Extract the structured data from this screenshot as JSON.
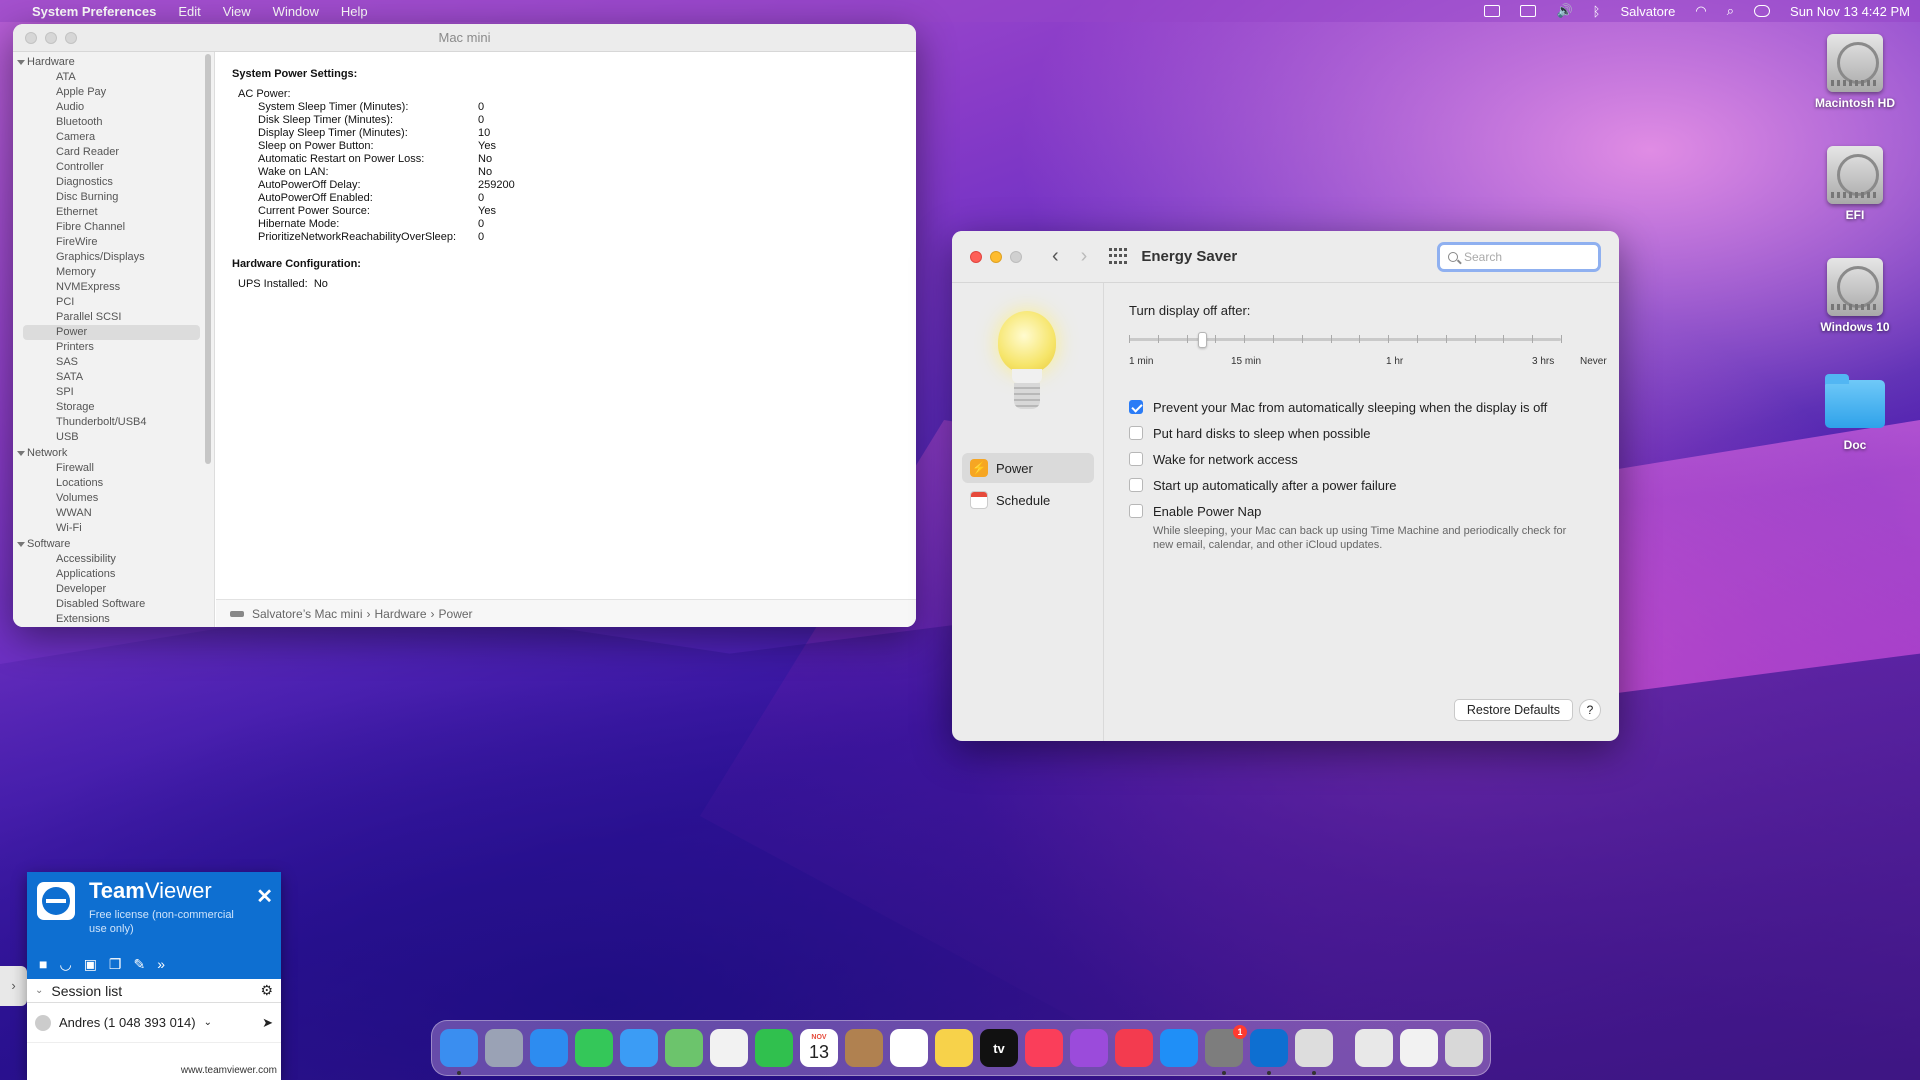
{
  "menubar": {
    "apple": "",
    "app": "System Preferences",
    "items": [
      "Edit",
      "View",
      "Window",
      "Help"
    ],
    "user": "Salvatore",
    "clock": "Sun Nov 13  4:42 PM"
  },
  "sysinfo": {
    "title": "Mac mini",
    "tree": [
      {
        "h": "Hardware"
      },
      {
        "i": "ATA"
      },
      {
        "i": "Apple Pay"
      },
      {
        "i": "Audio"
      },
      {
        "i": "Bluetooth"
      },
      {
        "i": "Camera"
      },
      {
        "i": "Card Reader"
      },
      {
        "i": "Controller"
      },
      {
        "i": "Diagnostics"
      },
      {
        "i": "Disc Burning"
      },
      {
        "i": "Ethernet"
      },
      {
        "i": "Fibre Channel"
      },
      {
        "i": "FireWire"
      },
      {
        "i": "Graphics/Displays"
      },
      {
        "i": "Memory"
      },
      {
        "i": "NVMExpress"
      },
      {
        "i": "PCI"
      },
      {
        "i": "Parallel SCSI"
      },
      {
        "i": "Power",
        "sel": true
      },
      {
        "i": "Printers"
      },
      {
        "i": "SAS"
      },
      {
        "i": "SATA"
      },
      {
        "i": "SPI"
      },
      {
        "i": "Storage"
      },
      {
        "i": "Thunderbolt/USB4"
      },
      {
        "i": "USB"
      },
      {
        "h": "Network"
      },
      {
        "i": "Firewall"
      },
      {
        "i": "Locations"
      },
      {
        "i": "Volumes"
      },
      {
        "i": "WWAN"
      },
      {
        "i": "Wi-Fi"
      },
      {
        "h": "Software"
      },
      {
        "i": "Accessibility"
      },
      {
        "i": "Applications"
      },
      {
        "i": "Developer"
      },
      {
        "i": "Disabled Software"
      },
      {
        "i": "Extensions"
      }
    ],
    "heading1": "System Power Settings:",
    "ac_power": "AC Power:",
    "settings": [
      {
        "k": "System Sleep Timer (Minutes):",
        "v": "0"
      },
      {
        "k": "Disk Sleep Timer (Minutes):",
        "v": "0"
      },
      {
        "k": "Display Sleep Timer (Minutes):",
        "v": "10"
      },
      {
        "k": "Sleep on Power Button:",
        "v": "Yes"
      },
      {
        "k": "Automatic Restart on Power Loss:",
        "v": "No"
      },
      {
        "k": "Wake on LAN:",
        "v": "No"
      },
      {
        "k": "AutoPowerOff Delay:",
        "v": "259200"
      },
      {
        "k": "AutoPowerOff Enabled:",
        "v": "0"
      },
      {
        "k": "Current Power Source:",
        "v": "Yes"
      },
      {
        "k": "Hibernate Mode:",
        "v": "0"
      },
      {
        "k": "PrioritizeNetworkReachabilityOverSleep:",
        "v": "0"
      }
    ],
    "heading2": "Hardware Configuration:",
    "ups_label": "UPS Installed:",
    "ups_value": "No",
    "path": [
      "Salvatore’s Mac mini",
      "Hardware",
      "Power"
    ]
  },
  "energy": {
    "title": "Energy Saver",
    "search_placeholder": "Search",
    "sidebar": [
      {
        "label": "Power",
        "icon": "power-icon"
      },
      {
        "label": "Schedule",
        "icon": "calendar-icon"
      }
    ],
    "slider_label": "Turn display off after:",
    "slider_scale": [
      "1 min",
      "15 min",
      "1 hr",
      "3 hrs",
      "Never"
    ],
    "slider_ticks": 16,
    "slider_value_fraction": 0.17,
    "options": [
      {
        "label": "Prevent your Mac from automatically sleeping when the display is off",
        "checked": true
      },
      {
        "label": "Put hard disks to sleep when possible",
        "checked": false
      },
      {
        "label": "Wake for network access",
        "checked": false
      },
      {
        "label": "Start up automatically after a power failure",
        "checked": false
      },
      {
        "label": "Enable Power Nap",
        "checked": false
      }
    ],
    "power_nap_note": "While sleeping, your Mac can back up using Time Machine and periodically check for new email, calendar, and other iCloud updates.",
    "restore_label": "Restore Defaults",
    "help_label": "?"
  },
  "desktop": [
    "Macintosh HD",
    "EFI",
    "Windows 10",
    "Doc"
  ],
  "teamviewer": {
    "name_bold": "Team",
    "name_rest": "Viewer",
    "license": "Free license (non-commercial use only)",
    "session_list": "Session list",
    "user": "Andres (1 048 393 014)",
    "url": "www.teamviewer.com"
  },
  "dock": {
    "calendar_month": "NOV",
    "calendar_day": "13",
    "tv_label": "tv",
    "badge": "1",
    "apps": [
      {
        "name": "finder",
        "color": "#3a8ef0",
        "run": true
      },
      {
        "name": "launchpad",
        "color": "#9aa2b5"
      },
      {
        "name": "safari",
        "color": "#2d8cf0"
      },
      {
        "name": "messages",
        "color": "#34c759"
      },
      {
        "name": "mail",
        "color": "#3b9cf5"
      },
      {
        "name": "maps",
        "color": "#6cc46c"
      },
      {
        "name": "photos",
        "color": "#f2f2f2"
      },
      {
        "name": "facetime",
        "color": "#30c04e"
      },
      {
        "name": "calendar",
        "color": "#ffffff"
      },
      {
        "name": "contacts",
        "color": "#b08150"
      },
      {
        "name": "reminders",
        "color": "#ffffff"
      },
      {
        "name": "notes",
        "color": "#f7d24a"
      },
      {
        "name": "apple-tv",
        "color": "#111111"
      },
      {
        "name": "music",
        "color": "#fa3e5a"
      },
      {
        "name": "podcasts",
        "color": "#9b4bdb"
      },
      {
        "name": "news",
        "color": "#f33b4f"
      },
      {
        "name": "app-store",
        "color": "#1f8ff7"
      },
      {
        "name": "system-preferences",
        "color": "#7d7d7d",
        "run": true,
        "badge": true
      },
      {
        "name": "teamviewer",
        "color": "#0e6fd1",
        "run": true
      },
      {
        "name": "printer",
        "color": "#dddddd",
        "run": true
      }
    ],
    "extras": [
      {
        "name": "document",
        "color": "#e8e8e8"
      },
      {
        "name": "screen-sharing",
        "color": "#f2f2f2"
      },
      {
        "name": "trash",
        "color": "#d8d8d8"
      }
    ]
  }
}
